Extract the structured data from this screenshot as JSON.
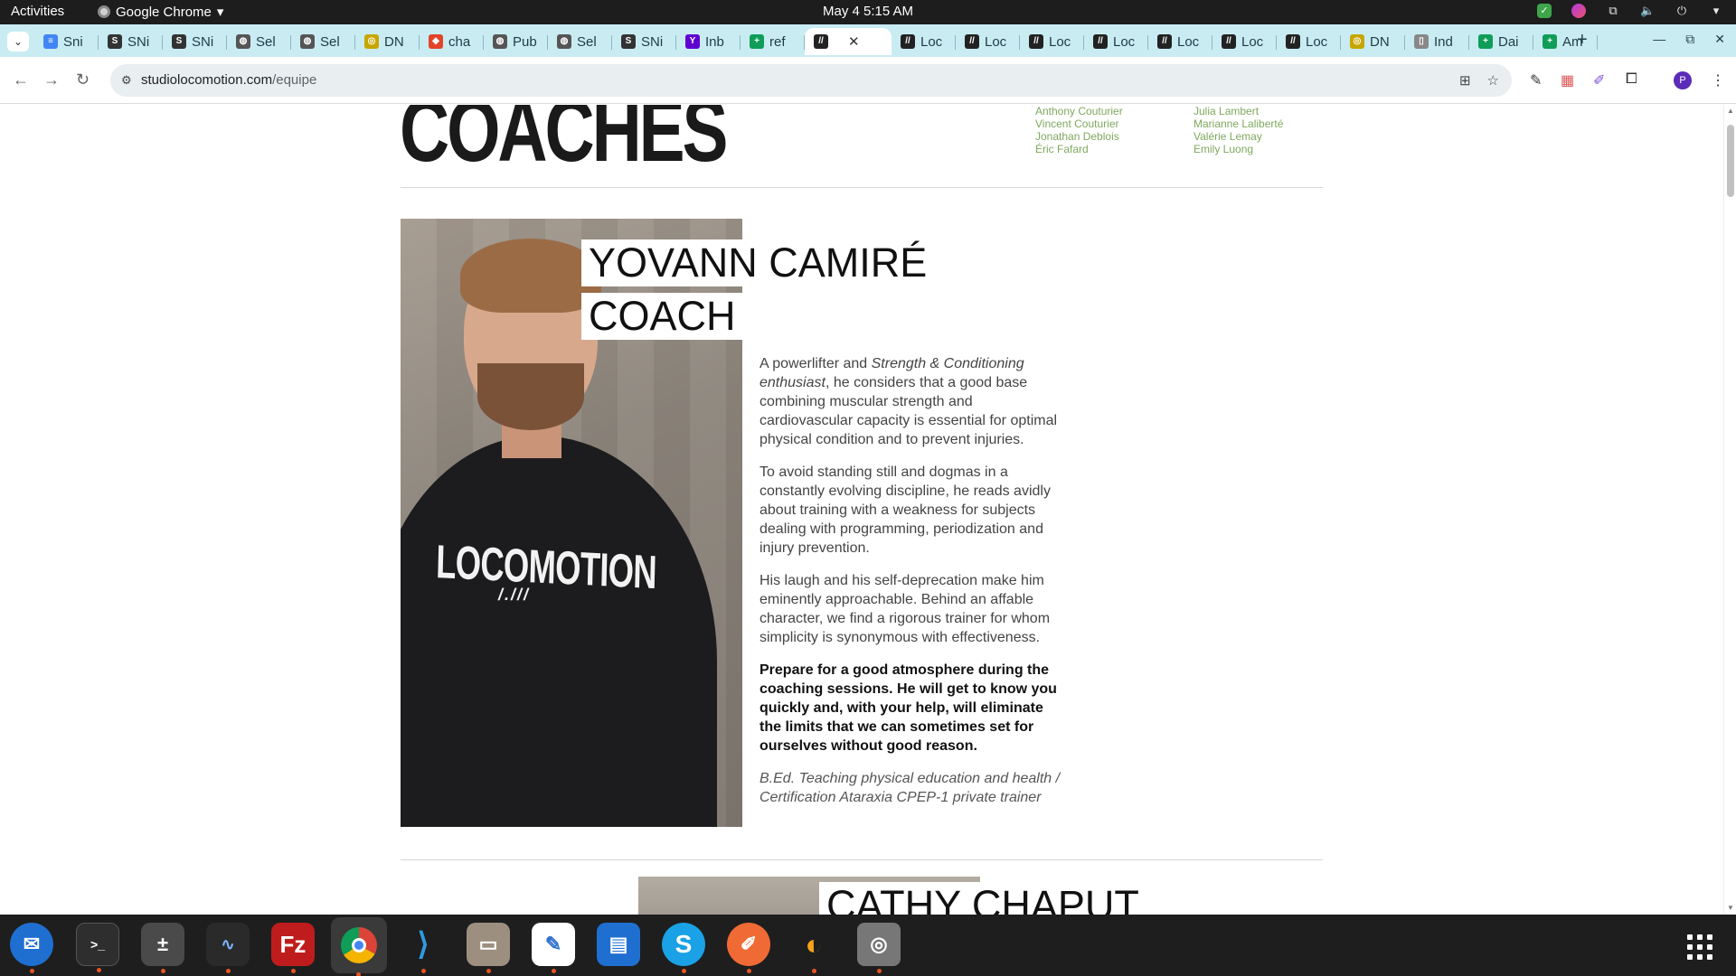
{
  "system": {
    "activities": "Activities",
    "app_name": "Google Chrome",
    "clock": "May 4  5:15 AM"
  },
  "tabs": [
    {
      "label": "Sni",
      "icon": "docs-icon",
      "color": "#4285f4"
    },
    {
      "label": "SNi",
      "icon": "snp-icon",
      "color": "#333333"
    },
    {
      "label": "SNi",
      "icon": "snp-icon",
      "color": "#333333"
    },
    {
      "label": "Sel",
      "icon": "globe-icon",
      "color": "#555555"
    },
    {
      "label": "Sel",
      "icon": "globe-icon",
      "color": "#555555"
    },
    {
      "label": "DN",
      "icon": "dna-icon",
      "color": "#c7a600"
    },
    {
      "label": "cha",
      "icon": "gitlab-icon",
      "color": "#e24329"
    },
    {
      "label": "Pub",
      "icon": "globe-icon",
      "color": "#555555"
    },
    {
      "label": "Sel",
      "icon": "globe-icon",
      "color": "#555555"
    },
    {
      "label": "SNi",
      "icon": "snp-icon",
      "color": "#333333"
    },
    {
      "label": "Inb",
      "icon": "yahoo-icon",
      "color": "#5f01d1"
    },
    {
      "label": "ref",
      "icon": "sheets-icon",
      "color": "#0f9d58"
    },
    {
      "label": "",
      "icon": "locomotion-icon",
      "color": "#222222",
      "active": true
    },
    {
      "label": "Loc",
      "icon": "locomotion-icon",
      "color": "#222222"
    },
    {
      "label": "Loc",
      "icon": "locomotion-icon",
      "color": "#222222"
    },
    {
      "label": "Loc",
      "icon": "locomotion-icon",
      "color": "#222222"
    },
    {
      "label": "Loc",
      "icon": "locomotion-icon",
      "color": "#222222"
    },
    {
      "label": "Loc",
      "icon": "locomotion-icon",
      "color": "#222222"
    },
    {
      "label": "Loc",
      "icon": "locomotion-icon",
      "color": "#222222"
    },
    {
      "label": "Loc",
      "icon": "locomotion-icon",
      "color": "#222222"
    },
    {
      "label": "DN",
      "icon": "dna-icon",
      "color": "#c7a600"
    },
    {
      "label": "Ind",
      "icon": "doc-icon",
      "color": "#888888"
    },
    {
      "label": "Dai",
      "icon": "sheets-icon",
      "color": "#0f9d58"
    },
    {
      "label": "Am",
      "icon": "sheets-icon",
      "color": "#0f9d58"
    }
  ],
  "omnibox": {
    "host": "studiolocomotion.com",
    "path": "/equipe"
  },
  "profile_initial": "P",
  "page": {
    "heading": "COACHES",
    "index_col1": [
      "Anthony Couturier",
      "Vincent Couturier",
      "Jonathan Deblois",
      "Éric Fafard"
    ],
    "index_col2": [
      "Julia Lambert",
      "Marianne Laliberté",
      "Valérie Lemay",
      "Emily Luong"
    ],
    "coach": {
      "name": "YOVANN CAMIRÉ",
      "role": "COACH",
      "photo_shirt_text": "LOCOMOTION",
      "photo_shirt_mark": "/.///",
      "bio1_pre": "A powerlifter and ",
      "bio1_em": "Strength & Conditioning enthusiast",
      "bio1_post": ", he considers that a good base combining muscular strength and cardiovascular capacity is essential for optimal physical condition and to prevent injuries.",
      "bio2": "To avoid standing still and dogmas in a constantly evolving discipline, he reads avidly about training with a weakness for subjects dealing with programming, periodization and injury prevention.",
      "bio3": "His laugh and his self-deprecation make him eminently approachable. Behind an affable character, we find a rigorous trainer for whom simplicity is synonymous with effectiveness.",
      "bio4": "Prepare for a good atmosphere during the coaching sessions. He will get to know you quickly and, with your help, will eliminate the limits that we can sometimes set for ourselves without good reason.",
      "credentials": "B.Ed. Teaching physical education and health / Certification Ataraxia CPEP-1 private trainer"
    },
    "next_coach_name": "CATHY CHAPUT"
  },
  "colors": {
    "accent_link": "#7fa85e",
    "tabstrip": "#c9ecf3"
  }
}
